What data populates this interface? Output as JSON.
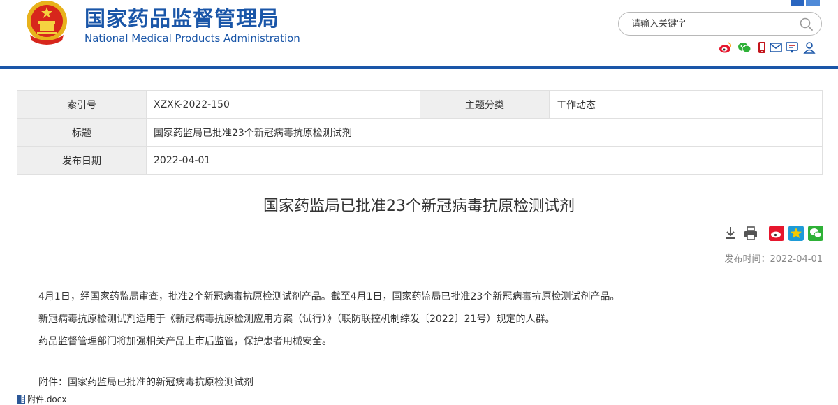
{
  "header": {
    "title_cn": "国家药品监督管理局",
    "title_en": "National Medical Products Administration",
    "search_placeholder": "请输入关键字",
    "brand_color": "#1a56a8"
  },
  "social_icons": [
    "weibo-icon",
    "wechat-icon",
    "mobile-icon",
    "email-icon",
    "message-icon",
    "user-icon"
  ],
  "meta": {
    "index_label": "索引号",
    "index_value": "XZXK-2022-150",
    "topic_label": "主题分类",
    "topic_value": "工作动态",
    "title_label": "标题",
    "title_value": "国家药监局已批准23个新冠病毒抗原检测试剂",
    "date_label": "发布日期",
    "date_value": "2022-04-01"
  },
  "article": {
    "title": "国家药监局已批准23个新冠病毒抗原检测试剂",
    "publish_time": "发布时间：2022-04-01",
    "paragraphs": [
      "4月1日，经国家药监局审查，批准2个新冠病毒抗原检测试剂产品。截至4月1日，国家药监局已批准23个新冠病毒抗原检测试剂产品。",
      "新冠病毒抗原检测试剂适用于《新冠病毒抗原检测应用方案（试行）》（联防联控机制综发〔2022〕21号）规定的人群。",
      "药品监督管理部门将加强相关产品上市后监管，保护患者用械安全。"
    ],
    "attachment_label": "附件：国家药监局已批准的新冠病毒抗原检测试剂",
    "attachment_file": "附件.docx"
  }
}
